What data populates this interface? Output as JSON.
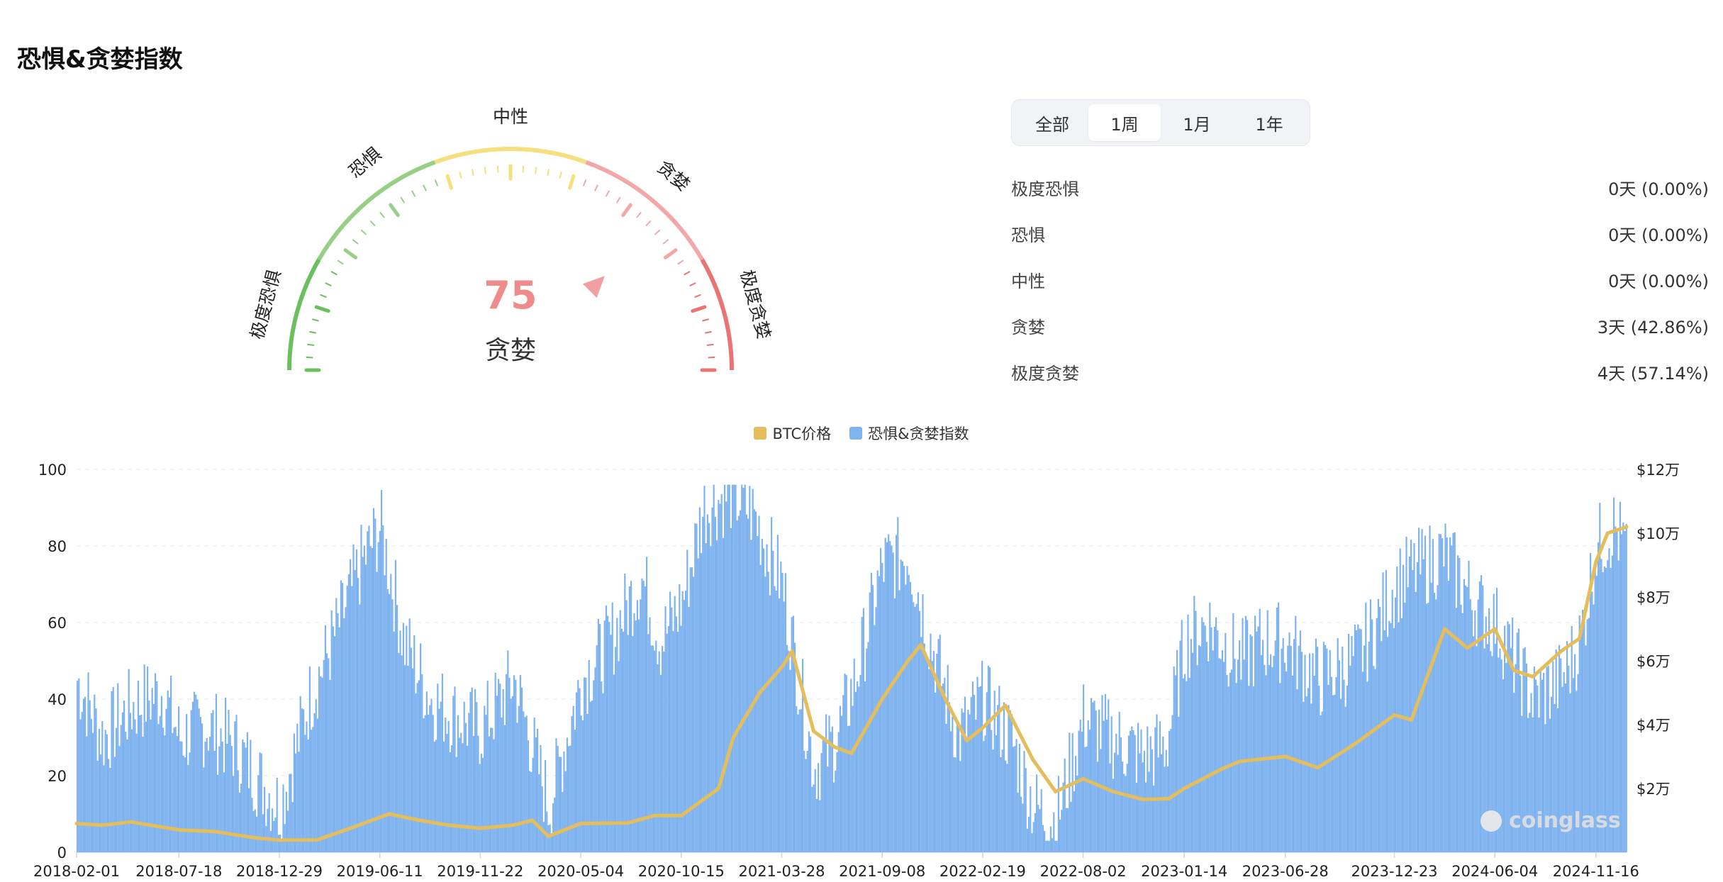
{
  "page": {
    "title": "恐惧&贪婪指数"
  },
  "gauge": {
    "value": 75,
    "value_text": "75",
    "status": "贪婪",
    "zones": [
      "极度恐惧",
      "恐惧",
      "中性",
      "贪婪",
      "极度贪婪"
    ],
    "zone_colors": [
      "#6cbf5f",
      "#98cf86",
      "#f5df7f",
      "#f2a8a8",
      "#ea7474"
    ],
    "pointer_color": "#f0a0a0"
  },
  "tabs": {
    "items": [
      "全部",
      "1周",
      "1月",
      "1年"
    ],
    "active": "1周"
  },
  "stats": [
    {
      "label": "极度恐惧",
      "value": "0天 (0.00%)"
    },
    {
      "label": "恐惧",
      "value": "0天 (0.00%)"
    },
    {
      "label": "中性",
      "value": "0天 (0.00%)"
    },
    {
      "label": "贪婪",
      "value": "3天 (42.86%)"
    },
    {
      "label": "极度贪婪",
      "value": "4天 (57.14%)"
    }
  ],
  "legend": {
    "btc": {
      "label": "BTC价格",
      "color": "#e4bd5c"
    },
    "fgi": {
      "label": "恐惧&贪婪指数",
      "color": "#7fb3ef"
    }
  },
  "watermark": "coinglass",
  "chart_data": {
    "type": "bar",
    "x_ticks": [
      "2018-02-01",
      "2018-07-18",
      "2018-12-29",
      "2019-06-11",
      "2019-11-22",
      "2020-05-04",
      "2020-10-15",
      "2021-03-28",
      "2021-09-08",
      "2022-02-19",
      "2022-08-02",
      "2023-01-14",
      "2023-06-28",
      "2023-12-23",
      "2024-06-04",
      "2024-11-16"
    ],
    "y_left": {
      "ticks": [
        "0",
        "20",
        "40",
        "60",
        "80",
        "100"
      ],
      "range": [
        0,
        100
      ]
    },
    "y_right": {
      "ticks": [
        "$2万",
        "$4万",
        "$6万",
        "$8万",
        "$10万",
        "$12万"
      ],
      "range": [
        0,
        120000
      ]
    },
    "grid": true,
    "series": [
      {
        "name": "恐惧&贪婪指数",
        "type": "bar",
        "axis": "left",
        "color": "#7fb3ef",
        "x_dates": [
          "2018-02-01",
          "2018-03-15",
          "2018-05-01",
          "2018-06-20",
          "2018-07-18",
          "2018-09-01",
          "2018-10-15",
          "2018-11-20",
          "2018-12-29",
          "2019-02-15",
          "2019-04-01",
          "2019-05-10",
          "2019-06-11",
          "2019-07-20",
          "2019-09-01",
          "2019-10-15",
          "2019-11-22",
          "2020-01-15",
          "2020-03-12",
          "2020-04-10",
          "2020-05-04",
          "2020-06-20",
          "2020-08-10",
          "2020-09-10",
          "2020-10-15",
          "2020-11-20",
          "2021-01-05",
          "2021-02-10",
          "2021-03-28",
          "2021-05-19",
          "2021-06-25",
          "2021-07-25",
          "2021-09-08",
          "2021-10-20",
          "2021-11-25",
          "2022-01-10",
          "2022-02-19",
          "2022-04-05",
          "2022-05-12",
          "2022-06-18",
          "2022-08-02",
          "2022-09-15",
          "2022-11-09",
          "2022-12-15",
          "2023-01-14",
          "2023-02-20",
          "2023-04-15",
          "2023-05-20",
          "2023-06-28",
          "2023-08-20",
          "2023-10-20",
          "2023-11-25",
          "2023-12-23",
          "2024-02-10",
          "2024-03-12",
          "2024-05-01",
          "2024-06-04",
          "2024-08-05",
          "2024-09-20",
          "2024-10-20",
          "2024-11-16",
          "2024-12-15",
          "2025-01-05"
        ],
        "values": [
          45,
          30,
          38,
          42,
          30,
          33,
          28,
          20,
          12,
          40,
          58,
          75,
          85,
          55,
          40,
          35,
          32,
          45,
          12,
          30,
          45,
          55,
          72,
          55,
          65,
          90,
          94,
          88,
          70,
          22,
          30,
          45,
          75,
          78,
          55,
          30,
          40,
          30,
          12,
          8,
          35,
          30,
          25,
          28,
          55,
          60,
          50,
          55,
          55,
          45,
          50,
          60,
          70,
          75,
          78,
          65,
          60,
          40,
          45,
          55,
          80,
          85,
          78
        ]
      },
      {
        "name": "BTC价格",
        "type": "line",
        "axis": "right",
        "color": "#e4bd5c",
        "x_dates": [
          "2018-02-01",
          "2018-03-15",
          "2018-05-01",
          "2018-07-18",
          "2018-09-15",
          "2018-11-20",
          "2018-12-29",
          "2019-03-01",
          "2019-05-01",
          "2019-06-26",
          "2019-08-15",
          "2019-10-01",
          "2019-11-22",
          "2020-01-15",
          "2020-02-15",
          "2020-03-12",
          "2020-05-04",
          "2020-07-20",
          "2020-09-01",
          "2020-10-15",
          "2020-12-15",
          "2021-01-08",
          "2021-02-20",
          "2021-03-28",
          "2021-04-14",
          "2021-05-19",
          "2021-06-22",
          "2021-07-20",
          "2021-09-08",
          "2021-10-20",
          "2021-11-10",
          "2021-12-20",
          "2022-01-24",
          "2022-02-19",
          "2022-03-28",
          "2022-05-12",
          "2022-06-18",
          "2022-08-02",
          "2022-09-20",
          "2022-11-09",
          "2022-12-20",
          "2023-01-14",
          "2023-03-15",
          "2023-04-15",
          "2023-06-28",
          "2023-08-20",
          "2023-10-20",
          "2023-12-23",
          "2024-01-20",
          "2024-03-14",
          "2024-04-20",
          "2024-06-04",
          "2024-07-05",
          "2024-08-05",
          "2024-09-20",
          "2024-10-20",
          "2024-11-16",
          "2024-12-05",
          "2025-01-05"
        ],
        "values": [
          9000,
          8500,
          9500,
          7000,
          6500,
          4500,
          3800,
          3900,
          8000,
          12000,
          10000,
          8500,
          7500,
          8500,
          10000,
          5000,
          9000,
          9200,
          11500,
          11500,
          20000,
          36000,
          50000,
          58000,
          63000,
          38000,
          33000,
          31000,
          48000,
          60000,
          65000,
          48000,
          35000,
          39000,
          46000,
          29000,
          19000,
          23000,
          19000,
          16500,
          16800,
          20000,
          26000,
          28500,
          30000,
          26500,
          34000,
          43000,
          41500,
          70000,
          64000,
          70000,
          57000,
          55000,
          63000,
          67000,
          91000,
          100000,
          102000
        ]
      }
    ]
  }
}
